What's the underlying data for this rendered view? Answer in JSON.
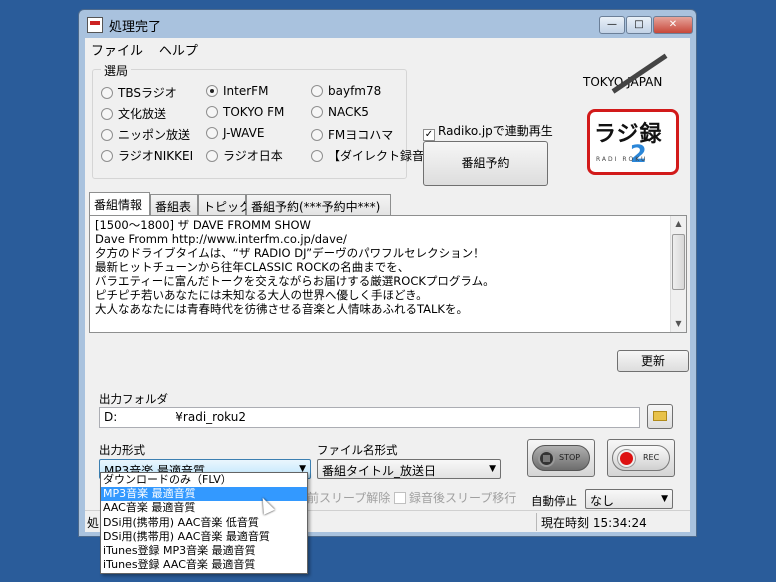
{
  "window": {
    "title": "処理完了",
    "controls": {
      "minimize": "—",
      "maximize": "□",
      "close": "✕"
    }
  },
  "menu": [
    "ファイル",
    "ヘルプ"
  ],
  "stations": {
    "legend": "選局",
    "selected": "InterFM",
    "items": [
      "TBSラジオ",
      "InterFM",
      "bayfm78",
      "文化放送",
      "TOKYO FM",
      "NACK5",
      "ニッポン放送",
      "J-WAVE",
      "FMヨコハマ",
      "ラジオNIKKEI",
      "ラジオ日本",
      "【ダイレクト録音】"
    ]
  },
  "radiko": {
    "label": "Radiko.jpで連動再生",
    "checked": true
  },
  "reserve_button": "番組予約",
  "logo": {
    "region": "TOKYO JAPAN",
    "main": "ラジ録",
    "two": "2",
    "sub": "RADI ROKU"
  },
  "tabs": [
    "番組情報",
    "番組表",
    "トピックス",
    "番組予約(***予約中***)"
  ],
  "program_text": [
    "[1500～1800] ザ DAVE FROMM SHOW",
    "Dave Fromm   http://www.interfm.co.jp/dave/",
    "夕方のドライブタイムは、“ザ RADIO DJ”デーヴのパワフルセレクション！",
    "最新ヒットチューンから往年CLASSIC ROCKの名曲までを、",
    "バラエティーに富んだトークを交えながらお届けする厳選ROCKプログラム。",
    "ピチピチ若いあなたには未知なる大人の世界へ優しく手ほどき。",
    "大人なあなたには青春時代を彷彿させる音楽と人情味あふれるTALKを。"
  ],
  "update_button": "更新",
  "output": {
    "folder_label": "出力フォルダ",
    "folder_prefix": "D:",
    "folder_suffix": "¥radi_roku2",
    "format_label": "出力形式",
    "format_value": "MP3音楽 最適音質",
    "filename_label": "ファイル名形式",
    "filename_value": "番組タイトル_放送日",
    "sleep_before": "前スリープ解除",
    "sleep_after": "録音後スリープ移行",
    "autostop_label": "自動停止",
    "autostop_value": "なし",
    "stop_label": "STOP",
    "rec_label": "REC"
  },
  "format_options": [
    "ダウンロードのみ（FLV）",
    "MP3音楽 最適音質",
    "AAC音楽 最適音質",
    "DSi用(携帯用) AAC音楽 低音質",
    "DSi用(携帯用) AAC音楽 最適音質",
    "iTunes登録 MP3音楽 最適音質",
    "iTunes登録 AAC音楽 最適音質"
  ],
  "status": {
    "left": "処",
    "current_time": "現在時刻 15:34:24"
  }
}
